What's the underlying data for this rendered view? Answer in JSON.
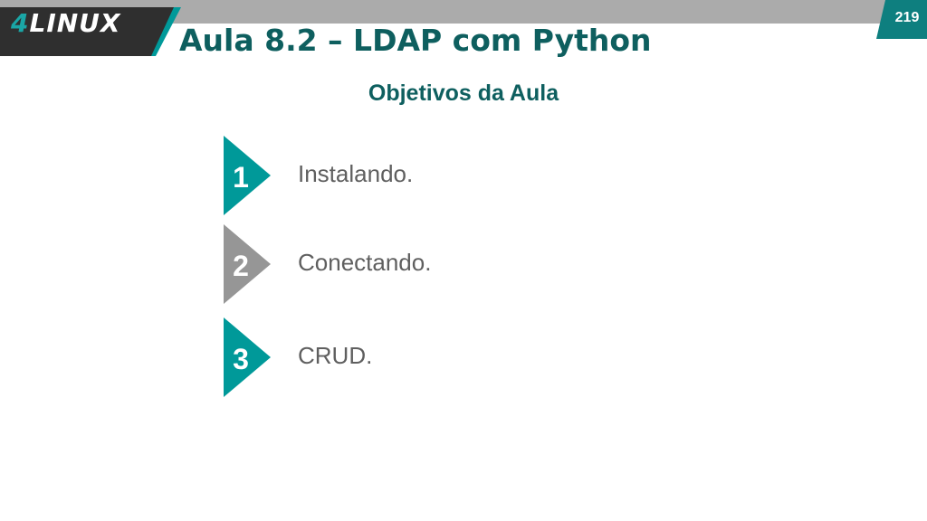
{
  "header": {
    "logo": {
      "num": "4",
      "text": "LINUX"
    },
    "title": "Aula 8.2 – LDAP com Python",
    "page_number": "219"
  },
  "main": {
    "subtitle": "Objetivos da Aula",
    "objectives": [
      {
        "num": "1",
        "label": "Instalando.",
        "color": "#009999"
      },
      {
        "num": "2",
        "label": "Conectando.",
        "color": "#969696"
      },
      {
        "num": "3",
        "label": "CRUD.",
        "color": "#009999"
      }
    ]
  },
  "colors": {
    "teal": "#009999",
    "dark_teal": "#0e5f5f",
    "gray_marker": "#969696",
    "top_bar": "#ababab",
    "logo_bg": "#2f2f2f",
    "text_gray": "#5f5f5f"
  }
}
